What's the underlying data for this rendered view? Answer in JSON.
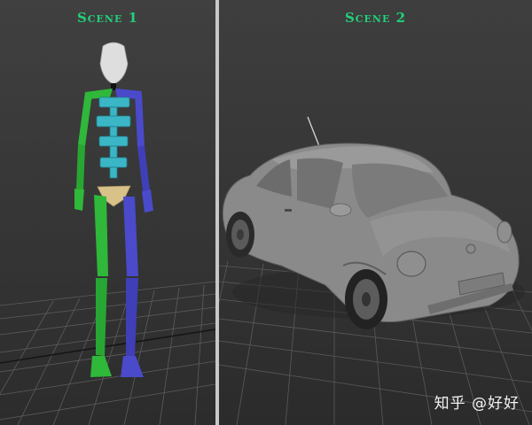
{
  "viewports": [
    {
      "title": "Scene 1",
      "content": "biped-skeleton"
    },
    {
      "title": "Scene 2",
      "content": "car-model"
    }
  ],
  "watermark": "知乎 @好好",
  "colors": {
    "title_green": "#22d07a",
    "bone_green": "#2fb83a",
    "bone_blue": "#4a4acb",
    "spine_cyan": "#3bb6c6",
    "pelvis_tan": "#d9c28a",
    "grid": "#5a5a5a",
    "car_gray": "#8a8a8a"
  }
}
